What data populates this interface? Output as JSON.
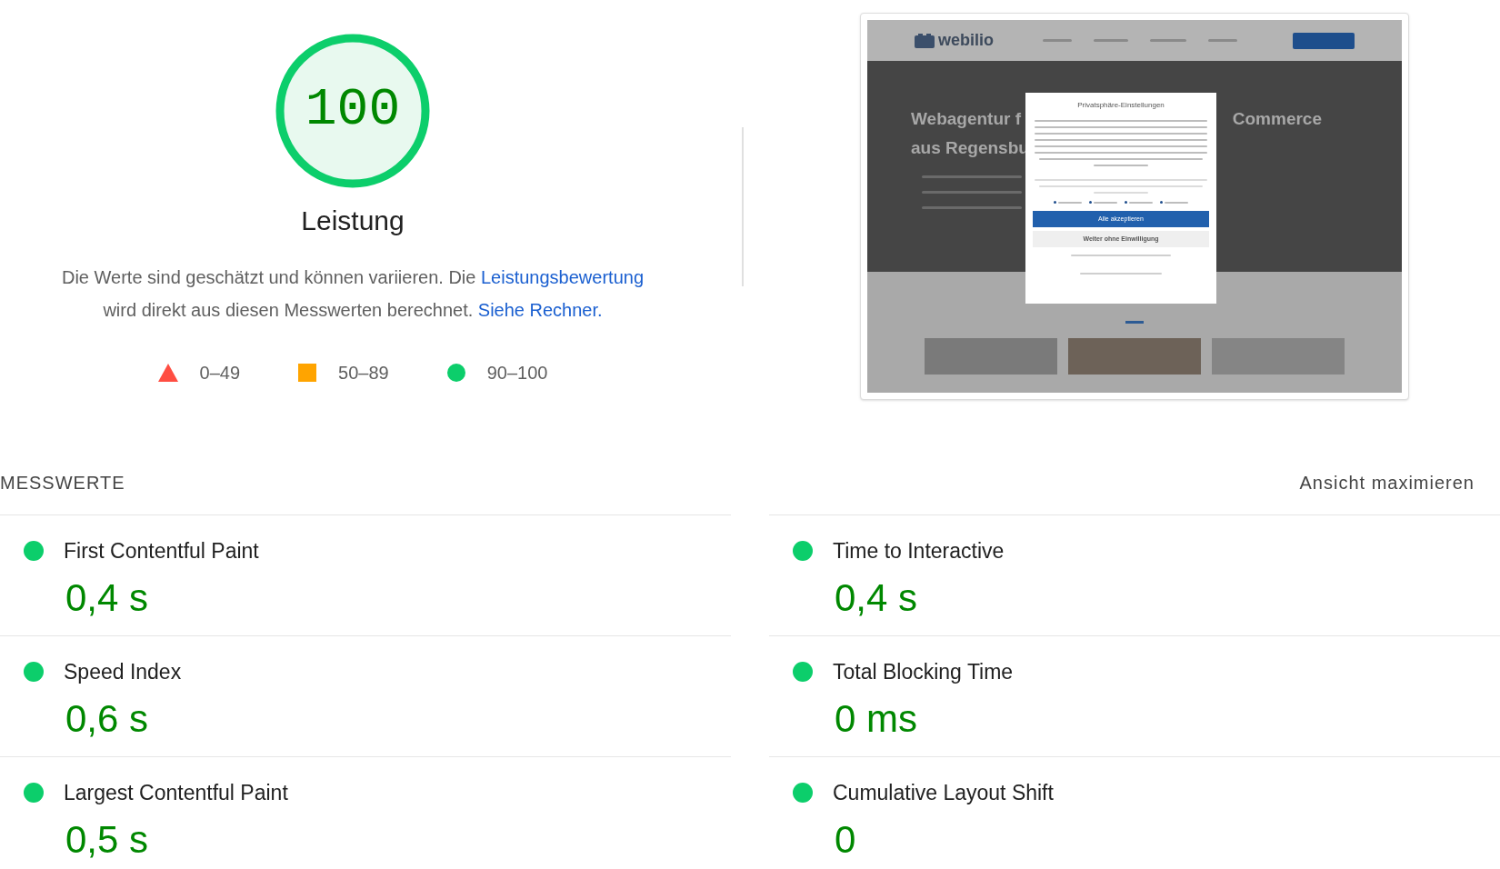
{
  "gauge": {
    "score": "100"
  },
  "category_title": "Leistung",
  "description": [
    {
      "kind": "text",
      "text": "Die Werte sind geschätzt und können variieren. Die "
    },
    {
      "kind": "link",
      "text": "Leistungsbewertung"
    },
    {
      "kind": "text",
      "text": " wird direkt aus diesen Messwerten berechnet. "
    },
    {
      "kind": "link",
      "text": "Siehe Rechner."
    }
  ],
  "legend": [
    {
      "kind": "fail",
      "label": "0–49"
    },
    {
      "kind": "average",
      "label": "50–89"
    },
    {
      "kind": "pass",
      "label": "90–100"
    }
  ],
  "screenshot": {
    "logo": "webilio",
    "headline_lines": [
      "Webagentur f",
      "aus Regensbu"
    ],
    "headline_right": "Commerce",
    "dialog": {
      "title": "Privatsphäre-Einstellungen",
      "buttons": [
        {
          "kind": "primary",
          "label": "Alle akzeptieren"
        },
        {
          "kind": "secondary",
          "label": "Weiter ohne Einwilligung"
        }
      ]
    }
  },
  "metrics": {
    "title": "MESSWERTE",
    "toggle": "Ansicht maximieren",
    "items": [
      {
        "label": "First Contentful Paint",
        "value": "0,4 s",
        "color": "#0cce6b"
      },
      {
        "label": "Time to Interactive",
        "value": "0,4 s",
        "color": "#0cce6b"
      },
      {
        "label": "Speed Index",
        "value": "0,6 s",
        "color": "#0cce6b"
      },
      {
        "label": "Total Blocking Time",
        "value": "0 ms",
        "color": "#0cce6b"
      },
      {
        "label": "Largest Contentful Paint",
        "value": "0,5 s",
        "color": "#0cce6b"
      },
      {
        "label": "Cumulative Layout Shift",
        "value": "0",
        "color": "#0cce6b"
      }
    ]
  }
}
